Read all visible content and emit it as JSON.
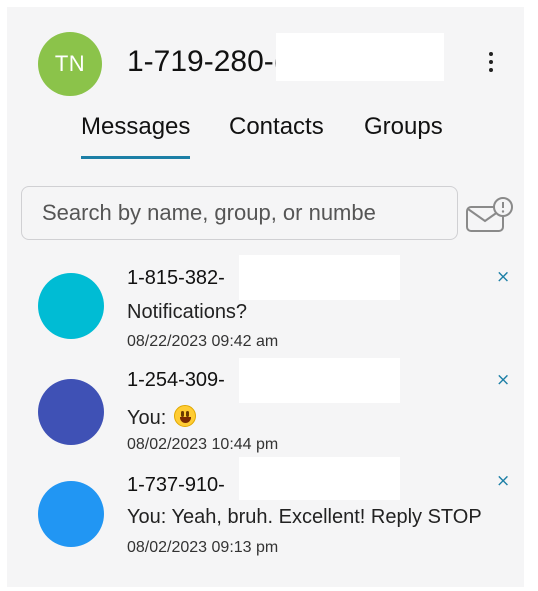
{
  "header": {
    "avatar_initials": "TN",
    "phone_number": "1-719-280-(",
    "menu_icon": "kebab-menu-icon"
  },
  "tabs": [
    {
      "label": "Messages",
      "active": true
    },
    {
      "label": "Contacts",
      "active": false
    },
    {
      "label": "Groups",
      "active": false
    }
  ],
  "search": {
    "placeholder": "Search by name, group, or numbe",
    "value": "",
    "action_icon": "mail-alert-icon"
  },
  "conversations": [
    {
      "name": "1-815-382-",
      "preview": "Notifications?",
      "preview_suffix": "",
      "time": "08/22/2023 09:42 am",
      "avatar_color": "#00bcd4"
    },
    {
      "name": "1-254-309-",
      "preview": "You: ",
      "preview_suffix": "grinning-emoji",
      "time": "08/02/2023 10:44 pm",
      "avatar_color": "#3f51b5"
    },
    {
      "name": "1-737-910-",
      "preview": "You: Yeah, bruh. Excellent! Reply STOP",
      "preview_suffix": "",
      "time": "08/02/2023 09:13 pm",
      "avatar_color": "#2196f3"
    }
  ],
  "close_glyph": "×",
  "colors": {
    "accent": "#1c7fa6",
    "my_avatar": "#8bc34a",
    "panel_bg": "#f5f5f6"
  }
}
